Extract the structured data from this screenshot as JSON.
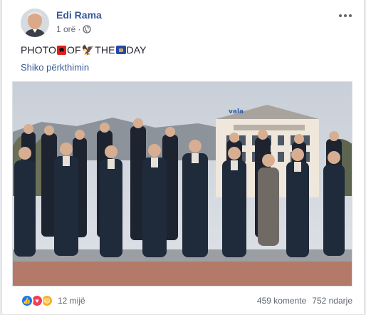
{
  "post": {
    "author": "Edi Rama",
    "time": "1 orë",
    "privacy_icon": "globe-icon",
    "text_parts": [
      "PHOTO",
      "OF",
      "THE",
      "DAY"
    ],
    "translate_link": "Shiko përkthimin",
    "photo_sign": "vala"
  },
  "footer": {
    "reactions_count": "12 mijë",
    "comments": "459 komente",
    "shares": "752 ndarje"
  },
  "colors": {
    "link": "#385898",
    "like": "#1877f2",
    "love": "#f33e58",
    "haha": "#f7b125"
  }
}
